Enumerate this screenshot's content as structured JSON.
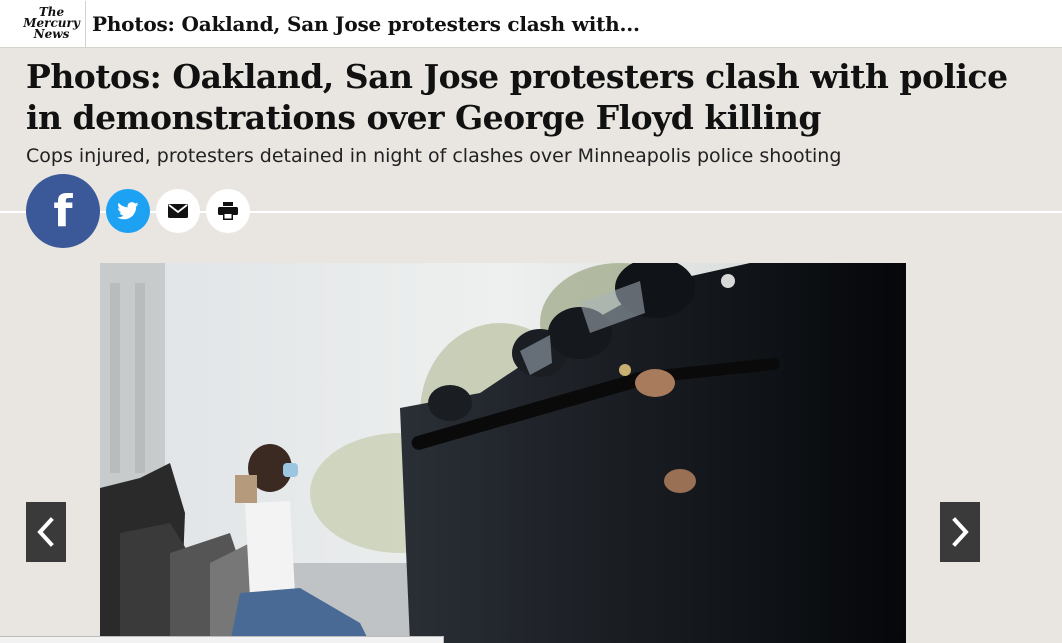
{
  "header": {
    "logo_lines": [
      "The",
      "Mercury",
      "News"
    ],
    "title": "Photos: Oakland, San Jose protesters clash with..."
  },
  "article": {
    "headline": "Photos: Oakland, San Jose protesters clash with police in demonstrations over George Floyd killing",
    "subhead": "Cops injured, protesters detained in night of clashes over Minneapolis police shooting"
  },
  "share": {
    "facebook_glyph": "f",
    "icons": [
      "facebook-icon",
      "twitter-icon",
      "email-icon",
      "print-icon"
    ],
    "colors": {
      "facebook": "#3b5998",
      "twitter": "#1da1f2"
    }
  },
  "gallery": {
    "prev_icon": "chevron-left-icon",
    "next_icon": "chevron-right-icon"
  }
}
